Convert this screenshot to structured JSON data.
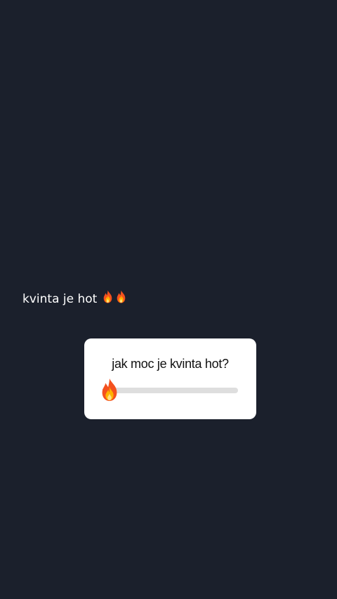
{
  "story": {
    "caption": "kvinta je hot",
    "caption_emoji": [
      "fire-icon",
      "fire-icon"
    ]
  },
  "slider": {
    "question": "jak moc je kvinta hot?",
    "emoji": "fire-icon",
    "value_percent": 4,
    "colors": {
      "fill": "#e0185f",
      "track": "#dedede"
    }
  },
  "colors": {
    "background": "#1b202c",
    "caption_text": "#ffffff",
    "card": "#ffffff"
  }
}
